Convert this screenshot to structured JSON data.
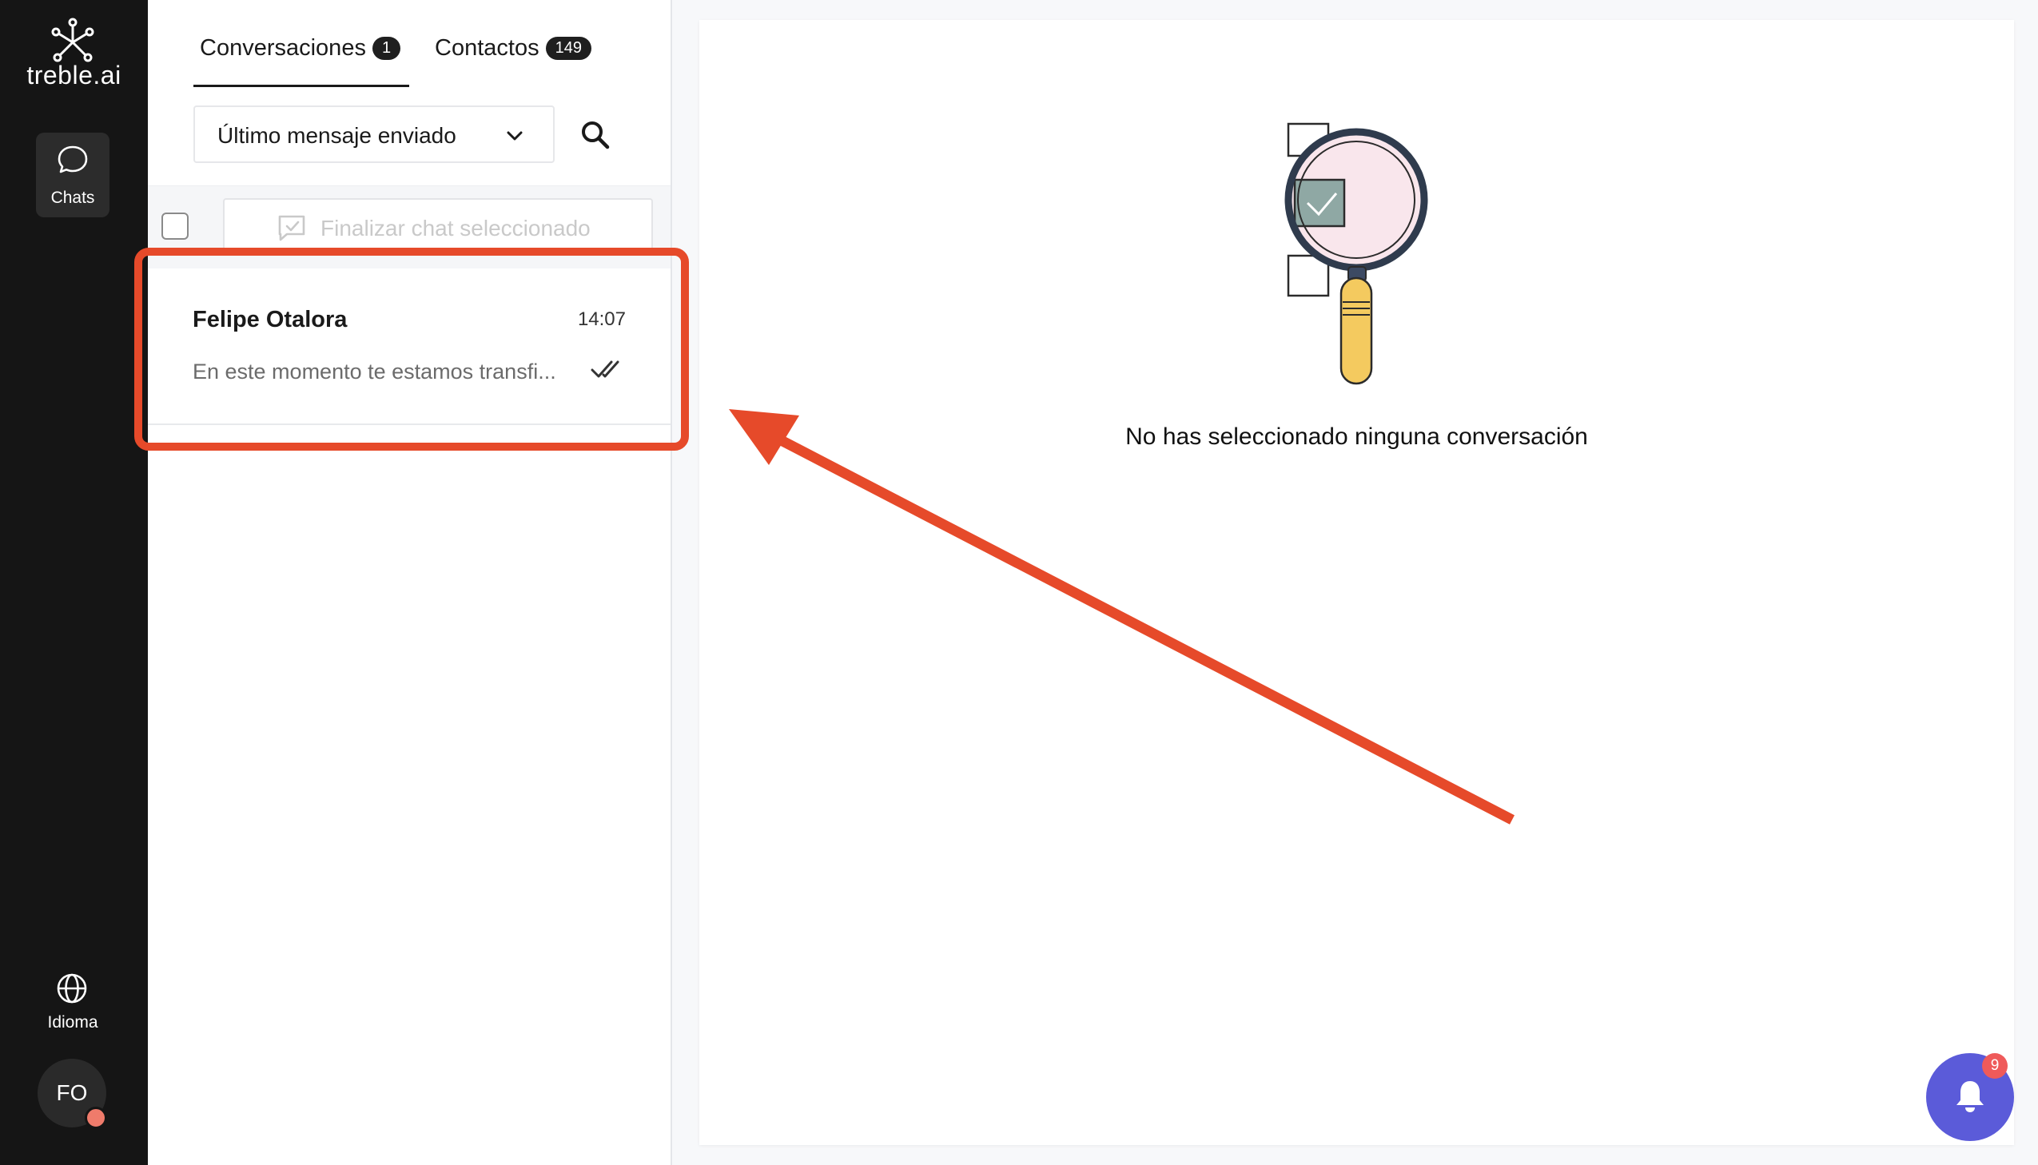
{
  "brand": {
    "name": "treble.ai"
  },
  "rail": {
    "chats_label": "Chats",
    "language_label": "Idioma",
    "avatar_initials": "FO"
  },
  "tabs": [
    {
      "label": "Conversaciones",
      "count": "1"
    },
    {
      "label": "Contactos",
      "count": "149"
    }
  ],
  "sort": {
    "selected": "Último mensaje enviado"
  },
  "toolbar": {
    "finalize_label": "Finalizar chat seleccionado"
  },
  "conversations": [
    {
      "name": "Felipe Otalora",
      "time": "14:07",
      "preview": "En este momento te estamos transfi..."
    }
  ],
  "main": {
    "empty_message": "No has seleccionado ninguna conversación"
  },
  "notifications": {
    "count": "9"
  },
  "colors": {
    "accent": "#5b5bd9",
    "annotation": "#e64a2a",
    "rail": "#151515"
  },
  "icons": [
    "treble-logo-icon",
    "chat-bubble-icon",
    "globe-icon",
    "chevron-down-icon",
    "search-icon",
    "finalize-chat-icon",
    "double-check-icon",
    "bell-icon",
    "magnifier-illustration"
  ]
}
